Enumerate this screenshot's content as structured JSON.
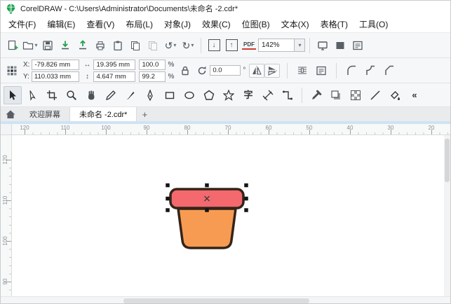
{
  "window": {
    "title": "CorelDRAW - C:\\Users\\Administrator\\Documents\\未命名 -2.cdr*"
  },
  "menu": {
    "items": [
      "文件(F)",
      "编辑(E)",
      "查看(V)",
      "布局(L)",
      "对象(J)",
      "效果(C)",
      "位图(B)",
      "文本(X)",
      "表格(T)",
      "工具(O)"
    ]
  },
  "toolbar": {
    "zoom": "142%",
    "pdf": "PDF"
  },
  "icons": {
    "dropdown": "▾",
    "undo": "↺",
    "redo": "↻",
    "arrow_down": "↓",
    "arrow_up": "↑",
    "width_arrow": "↔",
    "height_arrow": "↕",
    "overflow": "«"
  },
  "property_bar": {
    "x_label": "X:",
    "x_value": "-79.826 mm",
    "y_label": "Y:",
    "y_value": "110.033 mm",
    "width_value": "19.395 mm",
    "height_value": "4.647 mm",
    "scale_x": "100.0",
    "scale_y": "99.2",
    "percent": "%",
    "rotation": "0.0",
    "degree": "°"
  },
  "toolbox": {
    "text_glyph": "字"
  },
  "tabs": {
    "items": [
      {
        "label": "欢迎屏幕",
        "active": false
      },
      {
        "label": "未命名 -2.cdr*",
        "active": true
      }
    ],
    "add": "+"
  },
  "rulers": {
    "h": [
      "120",
      "110",
      "100",
      "90",
      "80",
      "70",
      "60",
      "50",
      "40",
      "30",
      "20"
    ],
    "v": [
      "120",
      "110",
      "100",
      "90"
    ]
  },
  "canvas": {
    "object": {
      "name": "flower-pot",
      "selected": true,
      "rim_fill": "#f3696e",
      "pot_fill": "#f89b52",
      "outline": "#33241a",
      "handle_color": "#151515"
    }
  }
}
